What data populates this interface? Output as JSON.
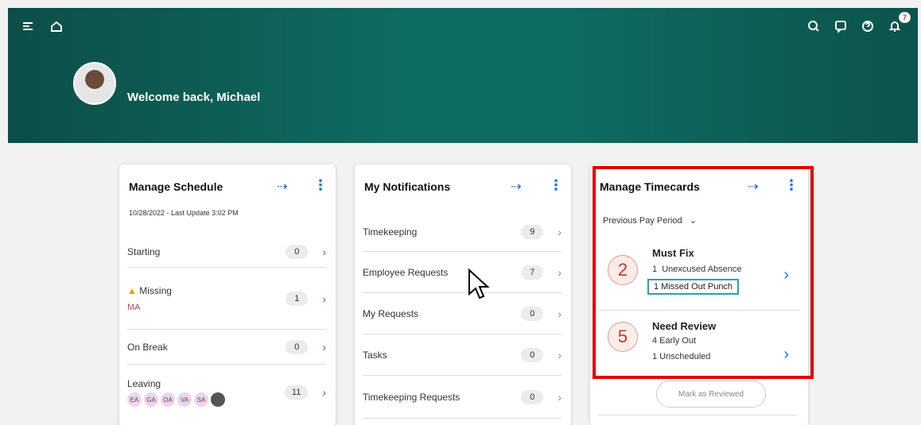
{
  "header": {
    "welcome": "Welcome back, Michael",
    "notification_count": "7"
  },
  "schedule": {
    "title": "Manage Schedule",
    "subtitle": "10/28/2022 - Last Update 3:02 PM",
    "rows": [
      {
        "label": "Starting",
        "count": "0"
      },
      {
        "label": "Missing",
        "count": "1",
        "initials": [
          "MA"
        ]
      },
      {
        "label": "On Break",
        "count": "0"
      },
      {
        "label": "Leaving",
        "count": "11",
        "initials": [
          "EA",
          "GA",
          "OA",
          "VA",
          "SA"
        ]
      }
    ]
  },
  "notifications": {
    "title": "My Notifications",
    "rows": [
      {
        "label": "Timekeeping",
        "count": "9"
      },
      {
        "label": "Employee Requests",
        "count": "7"
      },
      {
        "label": "My Requests",
        "count": "0"
      },
      {
        "label": "Tasks",
        "count": "0"
      },
      {
        "label": "Timekeeping Requests",
        "count": "0"
      }
    ]
  },
  "timecards": {
    "title": "Manage Timecards",
    "period": "Previous Pay Period",
    "must_fix": {
      "count": "2",
      "title": "Must Fix",
      "line1": "1  Unexcused Absence",
      "line2": "1 Missed Out Punch"
    },
    "need_review": {
      "count": "5",
      "title": "Need Review",
      "line1": "4 Early Out",
      "line2": "1 Unscheduled"
    },
    "mark_reviewed": "Mark as Reviewed"
  },
  "icons": [
    "menu-icon",
    "home-icon",
    "search-icon",
    "chat-icon",
    "help-icon",
    "bell-icon",
    "arrow-icon",
    "kebab-icon",
    "chevron-right-icon",
    "warning-icon",
    "chevron-down-icon"
  ],
  "colors": {
    "banner": "#0f6c62",
    "accent": "#2a6fd6",
    "highlight": "#e00000",
    "teal_box": "#2aa0b5"
  }
}
